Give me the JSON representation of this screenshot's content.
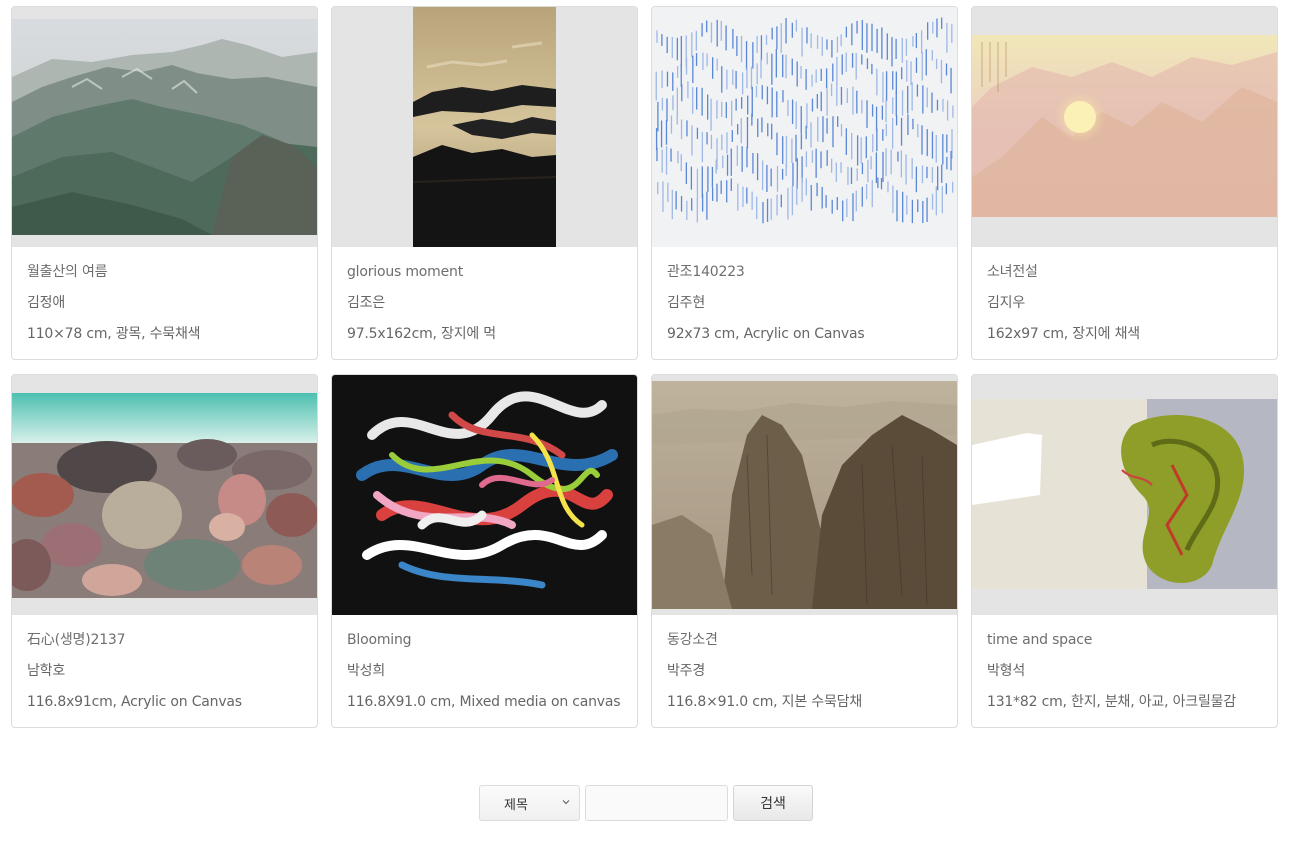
{
  "artworks": [
    {
      "title": "월출산의 여름",
      "artist": "김정애",
      "spec": "110×78 cm, 광목, 수묵채색",
      "image": "mountain-landscape-painting"
    },
    {
      "title": "glorious moment",
      "artist": "김조은",
      "spec": "97.5x162cm, 장지에 먹",
      "image": "ink-clouds-vertical-painting"
    },
    {
      "title": "관조140223",
      "artist": "김주현",
      "spec": "92x73 cm, Acrylic on Canvas",
      "image": "blue-lines-pattern-painting"
    },
    {
      "title": "소녀전설",
      "artist": "김지우",
      "spec": "162x97 cm, 장지에 채색",
      "image": "pink-sunrise-mountain-painting"
    },
    {
      "title": "石心(생명)2137",
      "artist": "남학호",
      "spec": "116.8x91cm, Acrylic on Canvas",
      "image": "pebble-beach-painting"
    },
    {
      "title": "Blooming",
      "artist": "박성희",
      "spec": "116.8X91.0 cm, Mixed media on canvas",
      "image": "colorful-abstract-painting"
    },
    {
      "title": "동강소견",
      "artist": "박주경",
      "spec": "116.8×91.0 cm, 지본 수묵담채",
      "image": "brown-cliff-ink-painting"
    },
    {
      "title": "time and space",
      "artist": "박형석",
      "spec": "131*82 cm, 한지, 분채, 아교, 아크릴물감",
      "image": "green-abstract-painting"
    }
  ],
  "search": {
    "field_select": "제목",
    "query": "",
    "button_label": "검색"
  }
}
